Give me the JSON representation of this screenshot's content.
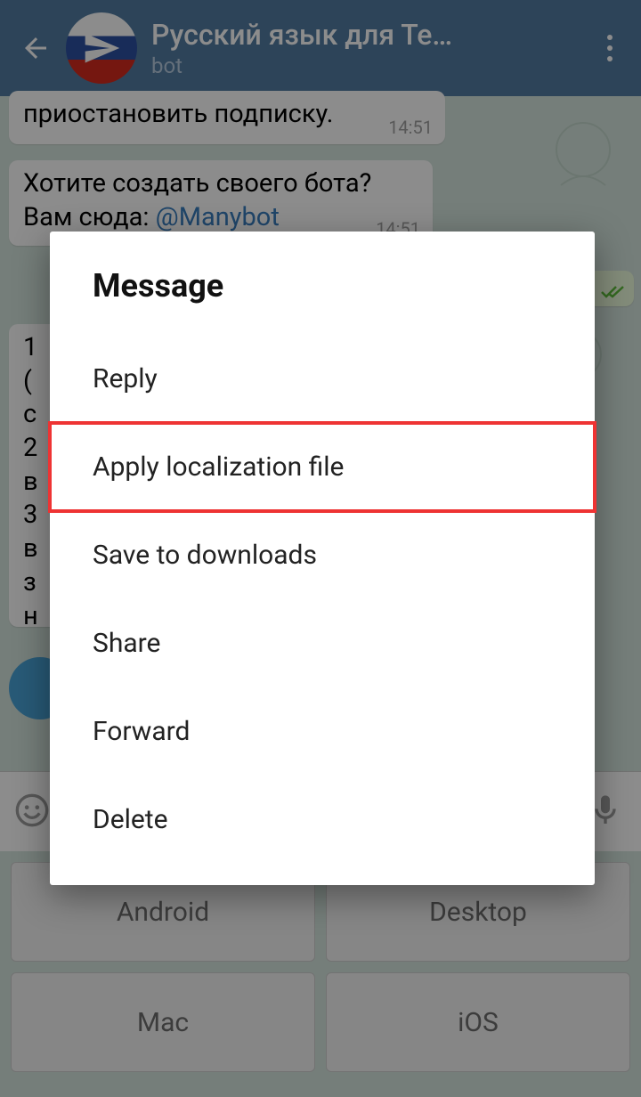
{
  "header": {
    "title": "Русский язык для Те…",
    "subtitle": "bot"
  },
  "messages": {
    "m1": {
      "text": "приостановить подписку.",
      "time": "14:51"
    },
    "m2": {
      "line1": "Хотите создать своего бота?",
      "line2_prefix": "Вам сюда: ",
      "line2_link": "@Manybot",
      "time": "14:51"
    },
    "m3_partial": [
      "1",
      "(",
      "с",
      "2",
      "в",
      "3",
      "в",
      "з",
      "н"
    ]
  },
  "dialog": {
    "title": "Message",
    "items": [
      "Reply",
      "Apply localization file",
      "Save to downloads",
      "Share",
      "Forward",
      "Delete"
    ],
    "highlight_index": 1
  },
  "keyboard": {
    "buttons": [
      "Android",
      "Desktop",
      "Mac",
      "iOS"
    ]
  }
}
